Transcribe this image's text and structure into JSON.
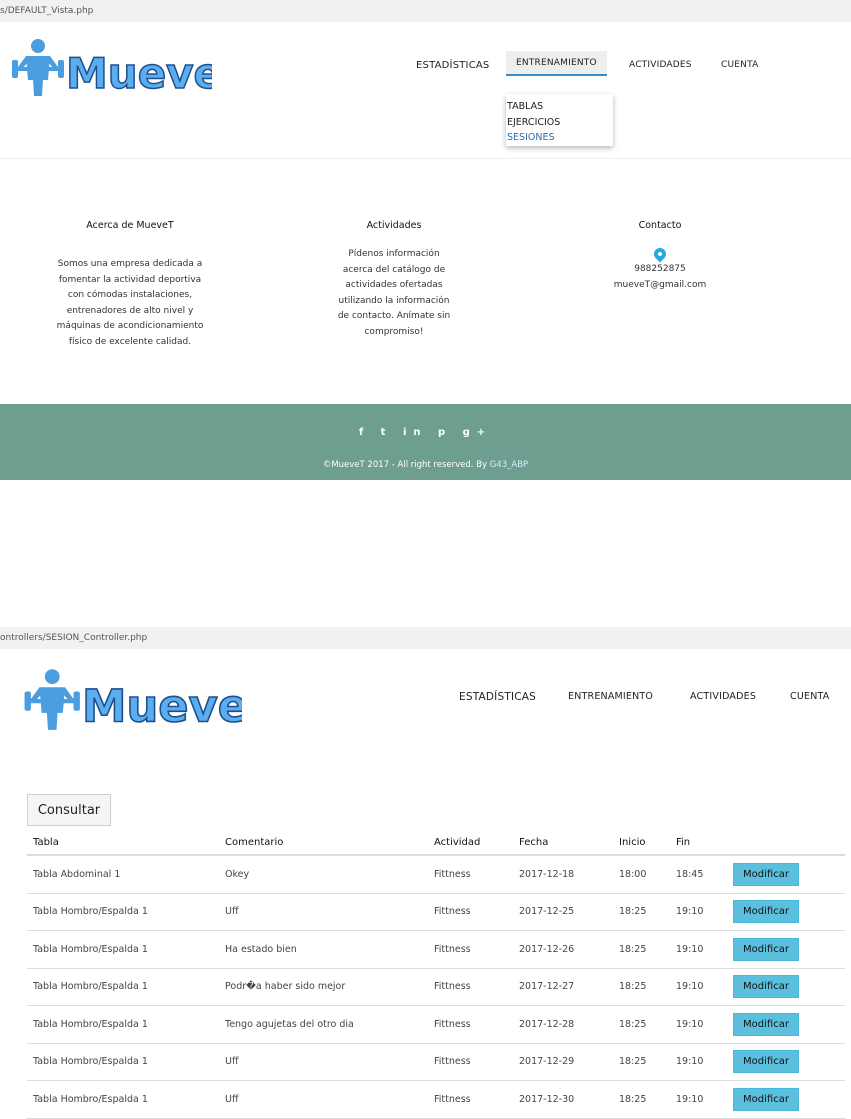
{
  "screen1": {
    "url": "s/DEFAULT_Vista.php",
    "nav": {
      "items": [
        "ESTADÍSTICAS",
        "ENTRENAMIENTO",
        "ACTIVIDADES",
        "CUENTA"
      ],
      "active": "ENTRENAMIENTO",
      "dropdown": [
        "TABLAS",
        "EJERCICIOS",
        "SESIONES"
      ]
    },
    "footer": {
      "about_title": "Acerca de MueveT",
      "about_text": "Somos una empresa dedicada a fomentar la actividad deportiva con cómodas instalaciones, entrenadores de alto nivel y máquinas de acondicionamiento físico de excelente calidad.",
      "activities_title": "Actividades",
      "activities_text": "Pídenos información acerca del catálogo de actividades ofertadas utilizando la información de contacto. Anímate sin compromiso!",
      "contact_title": "Contacto",
      "phone": "988252875",
      "email": "mueveT@gmail.com",
      "social": [
        "f",
        "t",
        "in",
        "p",
        "g+"
      ],
      "copyright": "©MueveT 2017 - All right reserved. By ",
      "author": "G43_ABP"
    }
  },
  "screen2": {
    "url": "ontrollers/SESION_Controller.php",
    "nav": {
      "items": [
        "ESTADÍSTICAS",
        "ENTRENAMIENTO",
        "ACTIVIDADES",
        "CUENTA"
      ]
    },
    "consult_label": "Consultar",
    "table": {
      "headers": [
        "Tabla",
        "Comentario",
        "Actividad",
        "Fecha",
        "Inicio",
        "Fin"
      ],
      "button_label": "Modificar",
      "rows": [
        [
          "Tabla Abdominal 1",
          "Okey",
          "Fittness",
          "2017-12-18",
          "18:00",
          "18:45"
        ],
        [
          "Tabla Hombro/Espalda 1",
          "Uff",
          "Fittness",
          "2017-12-25",
          "18:25",
          "19:10"
        ],
        [
          "Tabla Hombro/Espalda 1",
          "Ha estado bien",
          "Fittness",
          "2017-12-26",
          "18:25",
          "19:10"
        ],
        [
          "Tabla Hombro/Espalda 1",
          "Podr�a haber sido mejor",
          "Fittness",
          "2017-12-27",
          "18:25",
          "19:10"
        ],
        [
          "Tabla Hombro/Espalda 1",
          "Tengo agujetas del otro dia",
          "Fittness",
          "2017-12-28",
          "18:25",
          "19:10"
        ],
        [
          "Tabla Hombro/Espalda 1",
          "Uff",
          "Fittness",
          "2017-12-29",
          "18:25",
          "19:10"
        ],
        [
          "Tabla Hombro/Espalda 1",
          "Uff",
          "Fittness",
          "2017-12-30",
          "18:25",
          "19:10"
        ]
      ]
    }
  },
  "logo_text": "MueveT",
  "colors": {
    "accent": "#3a8bc7",
    "footer_green": "#6e9e8f",
    "button_blue": "#5bc0de",
    "logo_blue": "#4a9ee0"
  }
}
